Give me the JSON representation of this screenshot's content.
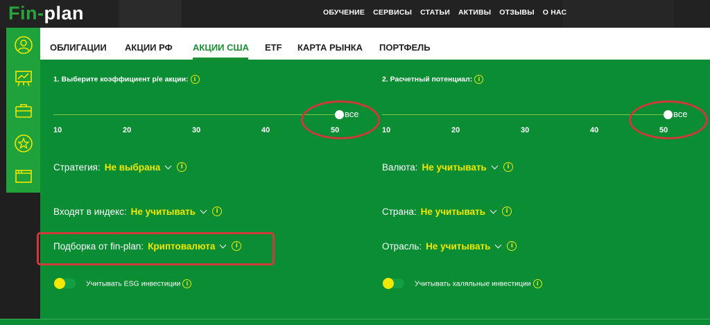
{
  "header": {
    "logo_part1": "Fin-",
    "logo_part2": "plan",
    "nav": [
      "ОБУЧЕНИЕ",
      "СЕРВИСЫ",
      "СТАТЬИ",
      "АКТИВЫ",
      "ОТЗЫВЫ",
      "О НАС"
    ]
  },
  "sidebar": {
    "icons": [
      "user-icon",
      "chart-board-icon",
      "briefcase-icon",
      "star-icon",
      "folder-icon"
    ]
  },
  "tabs": {
    "items": [
      "ОБЛИГАЦИИ",
      "АКЦИИ РФ",
      "АКЦИИ США",
      "ETF",
      "КАРТА РЫНКА",
      "ПОРТФЕЛЬ"
    ],
    "active": "АКЦИИ США"
  },
  "sliders": {
    "pe": {
      "label": "1. Выберите коэффициент p/e акции:",
      "ticks": [
        "10",
        "20",
        "30",
        "40",
        "50"
      ],
      "value_label": "все"
    },
    "potential": {
      "label": "2. Расчетный потенциал:",
      "ticks": [
        "10",
        "20",
        "30",
        "40",
        "50"
      ],
      "value_label": "все"
    }
  },
  "filters": {
    "strategy": {
      "label": "Стратегия:",
      "value": "Не выбрана"
    },
    "index": {
      "label": "Входят в индекс:",
      "value": "Не учитывать"
    },
    "selection": {
      "label": "Подборка от fin-plan:",
      "value": "Криптовалюта"
    },
    "currency": {
      "label": "Валюта:",
      "value": "Не учитывать"
    },
    "country": {
      "label": "Страна:",
      "value": "Не учитывать"
    },
    "industry": {
      "label": "Отрасль:",
      "value": "Не учитывать"
    }
  },
  "toggles": {
    "esg": {
      "label": "Учитывать ESG инвестиции",
      "enabled": false
    },
    "halal": {
      "label": "Учитывать халяльные инвестиции",
      "enabled": false
    }
  },
  "info_glyph": "i",
  "colors": {
    "panel_green": "#0a8d33",
    "accent_yellow": "#f2e800",
    "highlight_red": "#d13a3a",
    "tab_active": "#1c8f35"
  }
}
